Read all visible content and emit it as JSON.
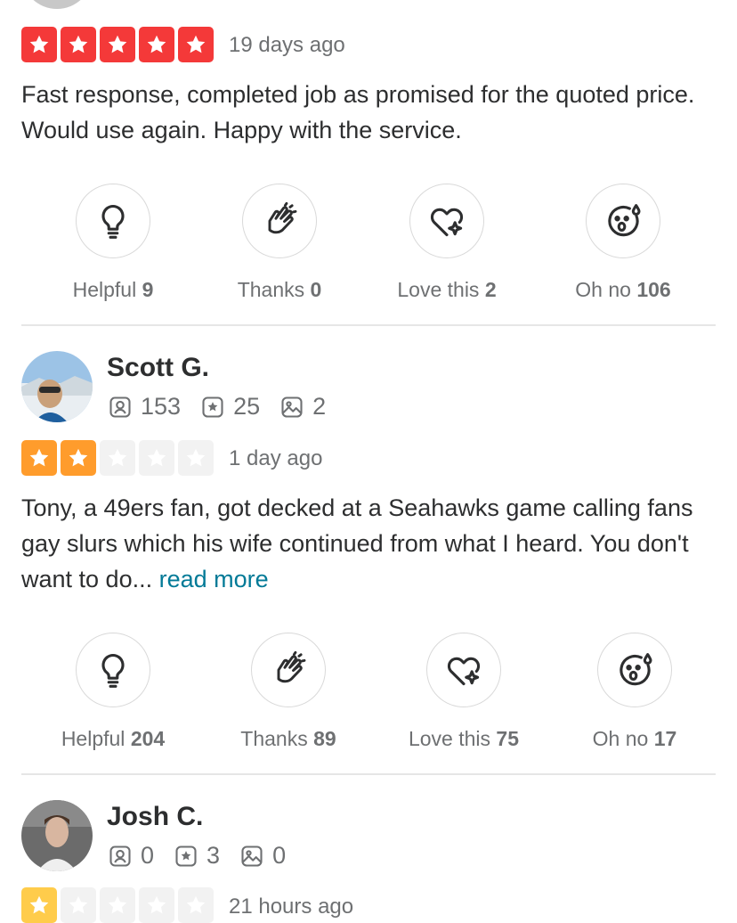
{
  "colors": {
    "star_red": "#f43939",
    "star_orange": "#ff9c2c",
    "star_yellow": "#ffcc4b",
    "star_empty": "#f2f2f2",
    "link": "#027a97"
  },
  "reaction_icons": [
    "lightbulb-icon",
    "clapping-hands-icon",
    "heart-sparkle-icon",
    "oh-no-face-icon"
  ],
  "reviews": [
    {
      "rating": 5,
      "date": "19 days ago",
      "text": "Fast response, completed job as promised for the quoted price. Would use again. Happy with the service.",
      "reactions": [
        {
          "label": "Helpful",
          "count": "9"
        },
        {
          "label": "Thanks",
          "count": "0"
        },
        {
          "label": "Love this",
          "count": "2"
        },
        {
          "label": "Oh no",
          "count": "106"
        }
      ]
    },
    {
      "name": "Scott G.",
      "stats": {
        "reviews": "153",
        "elite": "25",
        "photos": "2"
      },
      "rating": 2,
      "date": "1 day ago",
      "text": "Tony, a 49ers fan, got decked at a Seahawks game calling fans gay slurs which his wife continued from what I heard. You don't want to do...",
      "read_more": "read more",
      "reactions": [
        {
          "label": "Helpful",
          "count": "204"
        },
        {
          "label": "Thanks",
          "count": "89"
        },
        {
          "label": "Love this",
          "count": "75"
        },
        {
          "label": "Oh no",
          "count": "17"
        }
      ]
    },
    {
      "name": "Josh C.",
      "stats": {
        "reviews": "0",
        "elite": "3",
        "photos": "0"
      },
      "rating": 1,
      "date": "21 hours ago"
    }
  ]
}
